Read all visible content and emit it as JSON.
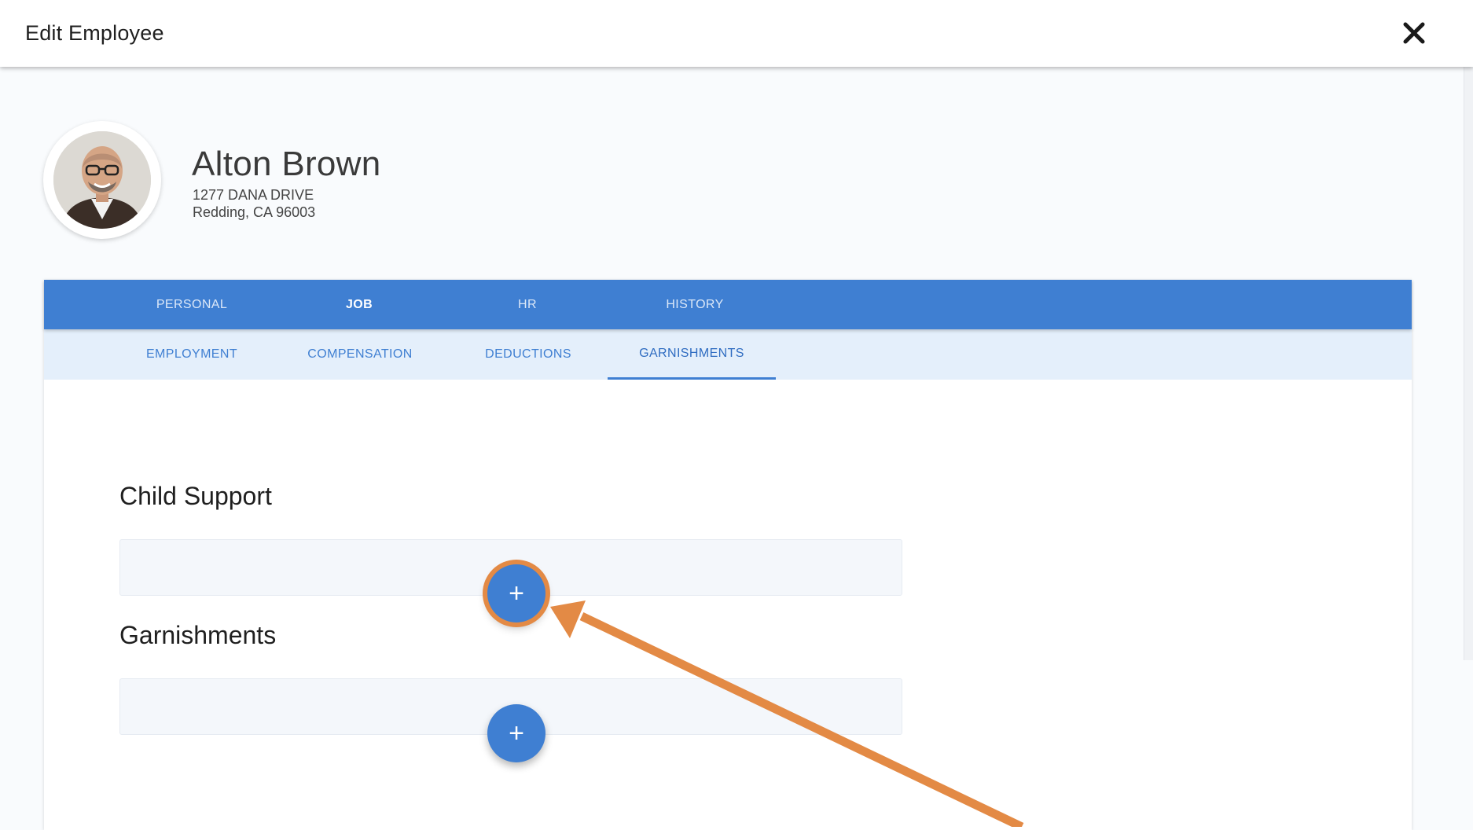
{
  "header": {
    "title": "Edit Employee",
    "close_icon": "close-icon"
  },
  "employee": {
    "name": "Alton Brown",
    "address_line1": "1277 DANA DRIVE",
    "address_line2": "Redding, CA 96003",
    "avatar_icon": "employee-photo"
  },
  "primary_tabs": [
    {
      "label": "PERSONAL",
      "active": false
    },
    {
      "label": "JOB",
      "active": true
    },
    {
      "label": "HR",
      "active": false
    },
    {
      "label": "HISTORY",
      "active": false
    }
  ],
  "secondary_tabs": [
    {
      "label": "EMPLOYMENT",
      "active": false
    },
    {
      "label": "COMPENSATION",
      "active": false
    },
    {
      "label": "DEDUCTIONS",
      "active": false
    },
    {
      "label": "GARNISHMENTS",
      "active": true
    }
  ],
  "sections": {
    "child_support": {
      "title": "Child Support",
      "add_icon": "plus-icon",
      "add_symbol": "+"
    },
    "garnishments": {
      "title": "Garnishments",
      "add_icon": "plus-icon",
      "add_symbol": "+"
    }
  },
  "colors": {
    "accent": "#3f7fd2",
    "highlight": "#e38a45",
    "secondary_tab_bg": "#e4effb"
  }
}
